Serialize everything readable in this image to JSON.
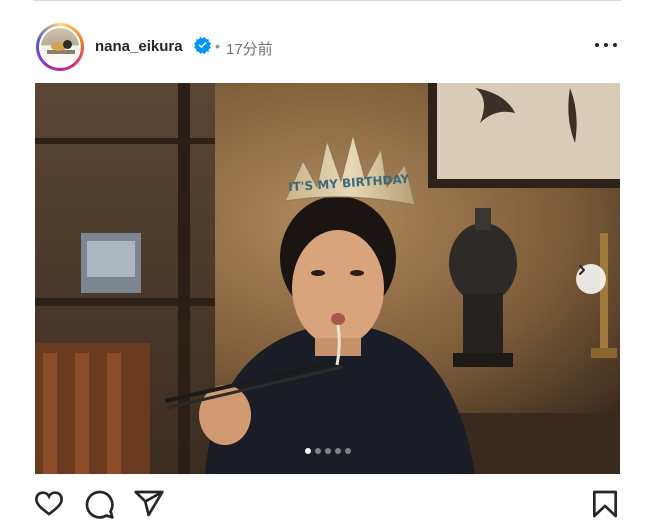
{
  "post": {
    "username": "nana_eikura",
    "verified_icon": "verified-badge-icon",
    "separator": "•",
    "time_ago": "17分前",
    "more_icon": "more-horizontal-icon"
  },
  "photo": {
    "tiara_text": "IT'S MY BIRTHDAY",
    "carousel": {
      "total": 5,
      "active": 1
    },
    "next_icon": "chevron-right-icon"
  },
  "actions": {
    "like_icon": "heart-icon",
    "comment_icon": "comment-icon",
    "share_icon": "send-icon",
    "save_icon": "bookmark-icon"
  },
  "colors": {
    "story_ring": [
      "#feda75",
      "#fa7e1e",
      "#d62976",
      "#962fbf",
      "#4f5bd5"
    ],
    "verified": "#0095f6",
    "text_primary": "#262626",
    "text_secondary": "#737373"
  }
}
